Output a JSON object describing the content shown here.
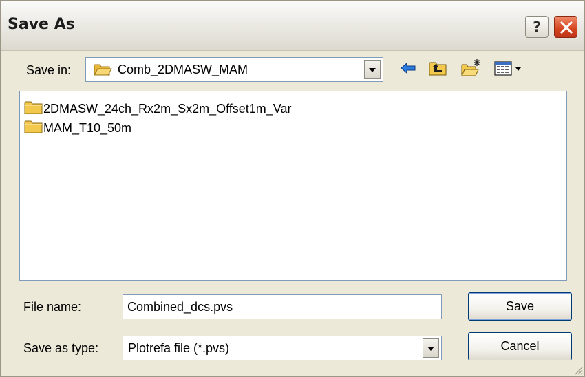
{
  "window": {
    "title": "Save As"
  },
  "titlebar": {
    "help_label": "?"
  },
  "save_in": {
    "label": "Save in:",
    "value": "Comb_2DMASW_MAM"
  },
  "toolbar": {
    "icons": [
      "back-arrow-icon",
      "up-one-level-icon",
      "create-new-folder-icon",
      "view-menu-icon"
    ]
  },
  "files": [
    {
      "name": "2DMASW_24ch_Rx2m_Sx2m_Offset1m_Var",
      "icon": "folder-icon"
    },
    {
      "name": "MAM_T10_50m",
      "icon": "folder-icon"
    }
  ],
  "file_name": {
    "label": "File name:",
    "value": "Combined_dcs.pvs"
  },
  "save_as_type": {
    "label": "Save as type:",
    "value": "Plotrefa file (*.pvs)"
  },
  "buttons": {
    "save": "Save",
    "cancel": "Cancel"
  },
  "colors": {
    "dialog_bg": "#ece9d8",
    "field_border": "#7f9db9",
    "close_red": "#d4451f",
    "folder_yellow": "#f2c94c",
    "back_arrow_blue": "#1f6fd1"
  }
}
